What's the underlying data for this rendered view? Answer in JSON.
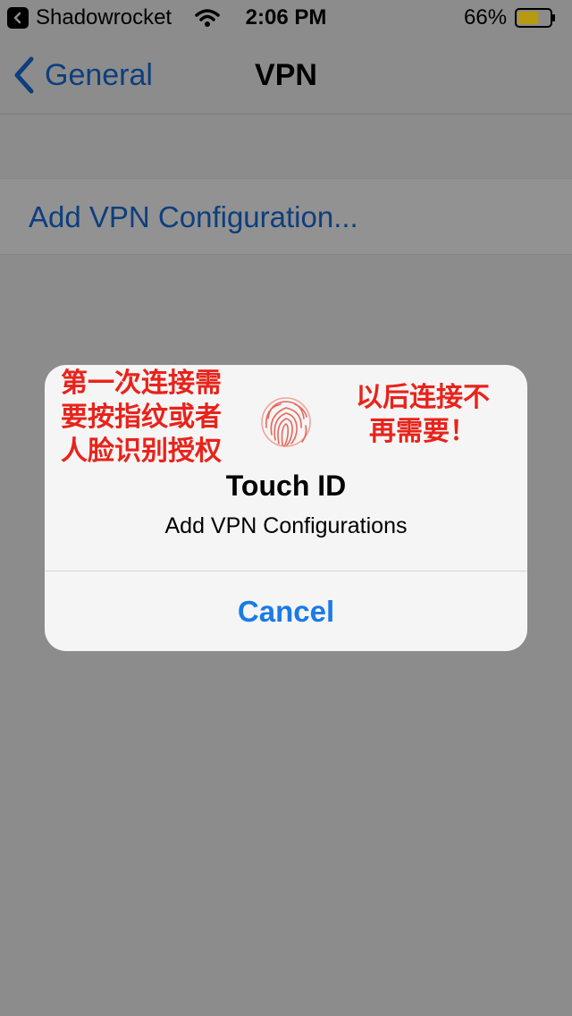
{
  "status_bar": {
    "back_app_label": "Shadowrocket",
    "time": "2:06 PM",
    "battery_percent": "66%",
    "battery_level": 0.66,
    "battery_color": "#b89a10"
  },
  "nav": {
    "back_label": "General",
    "title": "VPN"
  },
  "table": {
    "add_vpn_label": "Add VPN Configuration..."
  },
  "alert": {
    "annotation_left": "第一次连接需\n要按指纹或者\n人脸识别授权",
    "annotation_right": "以后连接不\n再需要！",
    "title": "Touch ID",
    "message": "Add VPN Configurations",
    "cancel_label": "Cancel"
  },
  "colors": {
    "link": "#0d3e7e",
    "button": "#1a7be6",
    "annotation": "#e8231b"
  }
}
